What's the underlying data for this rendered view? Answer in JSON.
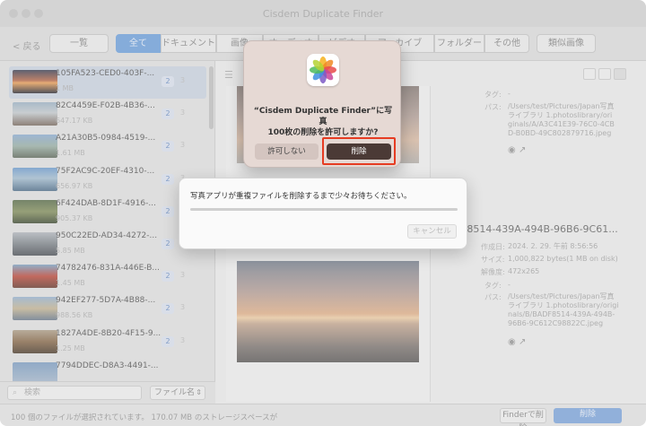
{
  "window": {
    "title": "Cisdem Duplicate Finder"
  },
  "toolbar": {
    "back_label": "< 戻る",
    "list_label": "一覧",
    "tabs": [
      "全て",
      "ドキュメント",
      "画像",
      "オーディオ",
      "ビデオ",
      "アーカイブ",
      "フォルダー",
      "その他"
    ],
    "similar_label": "類似画像"
  },
  "sidebar": {
    "items": [
      {
        "name": "105FA523-CED0-403F-...",
        "size": "1 MB",
        "count": "2",
        "count2": "3",
        "thumb": "sunset"
      },
      {
        "name": "82C4459E-F02B-4B36-...",
        "size": "647.17 KB",
        "count": "2",
        "count2": "3",
        "thumb": "town"
      },
      {
        "name": "A21A30B5-0984-4519-...",
        "size": "1.61 MB",
        "count": "2",
        "count2": "3",
        "thumb": "street"
      },
      {
        "name": "75F2AC9C-20EF-4310-...",
        "size": "656.97 KB",
        "count": "2",
        "count2": "3",
        "thumb": "harbor"
      },
      {
        "name": "6F424DAB-8D1F-4916-...",
        "size": "905.37 KB",
        "count": "2",
        "count2": "3",
        "thumb": "forest"
      },
      {
        "name": "950C22ED-AD34-4272-...",
        "size": "5.85 MB",
        "count": "2",
        "count2": "3",
        "thumb": "rails"
      },
      {
        "name": "74782476-831A-446E-B...",
        "size": "1.45 MB",
        "count": "2",
        "count2": "3",
        "thumb": "temple"
      },
      {
        "name": "942EF277-5D7A-4B88-...",
        "size": "988.56 KB",
        "count": "2",
        "count2": "3",
        "thumb": "city"
      },
      {
        "name": "1827A4DE-8B20-4F15-9...",
        "size": "1.25 MB",
        "count": "2",
        "count2": "3",
        "thumb": "gate"
      },
      {
        "name": "7794DDEC-D8A3-4491-...",
        "size": "",
        "count": "",
        "count2": "",
        "thumb": "sky"
      }
    ],
    "search_placeholder": "検索",
    "sort_label": "ファイル名"
  },
  "details": {
    "top": {
      "tag_label": "タグ:",
      "tag_value": "-",
      "path_label": "パス:",
      "path_value": "/Users/test/Pictures/Japan写真ライブラリ 1.photoslibrary/originals/A/A3C41E39-76C0-4CBD-B0BD-49C802879716.jpeg"
    },
    "bottom": {
      "filename": "F8514-439A-494B-96B6-9C61...",
      "created_label": "作成日:",
      "created_value": "2024. 2. 29. 午前 8:56:56",
      "size_label": "サイズ:",
      "size_value": "1,000,822 bytes(1 MB on disk)",
      "pixels_label": "解像度:",
      "pixels_value": "472x265",
      "tag_label": "タグ:",
      "tag_value": "-",
      "path_label": "パス:",
      "path_value": "/Users/test/Pictures/Japan写真ライブラリ 1.photoslibrary/originals/B/BADF8514-439A-494B-96B6-9C612C98822C.jpeg"
    }
  },
  "status": {
    "text": "100 個のファイルが選択されています。 170.07 MB のストレージスペースが",
    "finder_delete_label": "Finderで削除",
    "delete_label": "削除"
  },
  "permission_dialog": {
    "title_line1": "“Cisdem Duplicate Finder”に写真",
    "title_line2": "100枚の削除を許可しますか?",
    "deny_label": "許可しない",
    "allow_label": "削除"
  },
  "progress_dialog": {
    "message": "写真アプリが重複ファイルを削除するまで少々お待ちください。",
    "progress": 0,
    "cancel_label": "キャンセル"
  }
}
